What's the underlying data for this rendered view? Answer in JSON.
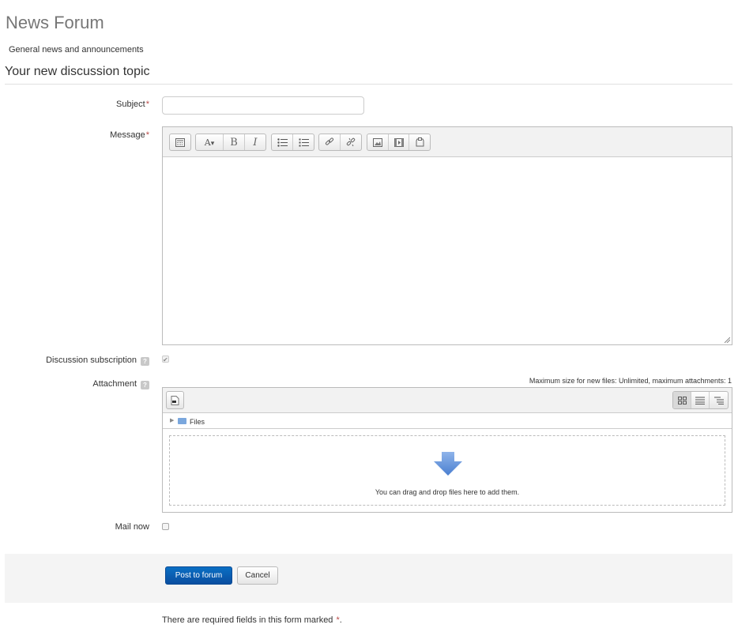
{
  "page": {
    "title": "News Forum",
    "intro": "General news and announcements"
  },
  "section": {
    "title": "Your new discussion topic"
  },
  "form": {
    "subject": {
      "label": "Subject",
      "required_mark": "*",
      "value": ""
    },
    "message": {
      "label": "Message",
      "required_mark": "*",
      "value": "",
      "toolbar": [
        "collapse-icon",
        "font-style-icon",
        "bold-icon",
        "italic-icon",
        "unordered-list-icon",
        "ordered-list-icon",
        "link-icon",
        "unlink-icon",
        "image-icon",
        "media-icon",
        "paste-icon"
      ],
      "bold_glyph": "B",
      "italic_glyph": "I",
      "font_style_glyph": "A"
    },
    "discussion_subscription": {
      "label": "Discussion subscription",
      "help": "?",
      "checked": true
    },
    "attachment": {
      "label": "Attachment",
      "help": "?",
      "max_size_text": "Maximum size for new files: Unlimited, maximum attachments: 1",
      "folder_label": "Files",
      "drop_text": "You can drag and drop files here to add them."
    },
    "mail_now": {
      "label": "Mail now",
      "checked": false
    }
  },
  "buttons": {
    "submit": "Post to forum",
    "cancel": "Cancel"
  },
  "required_note": {
    "text": "There are required fields in this form marked ",
    "mark": "*",
    "end": "."
  },
  "colors": {
    "primary": "#0a5db3",
    "required": "#b94a48"
  }
}
